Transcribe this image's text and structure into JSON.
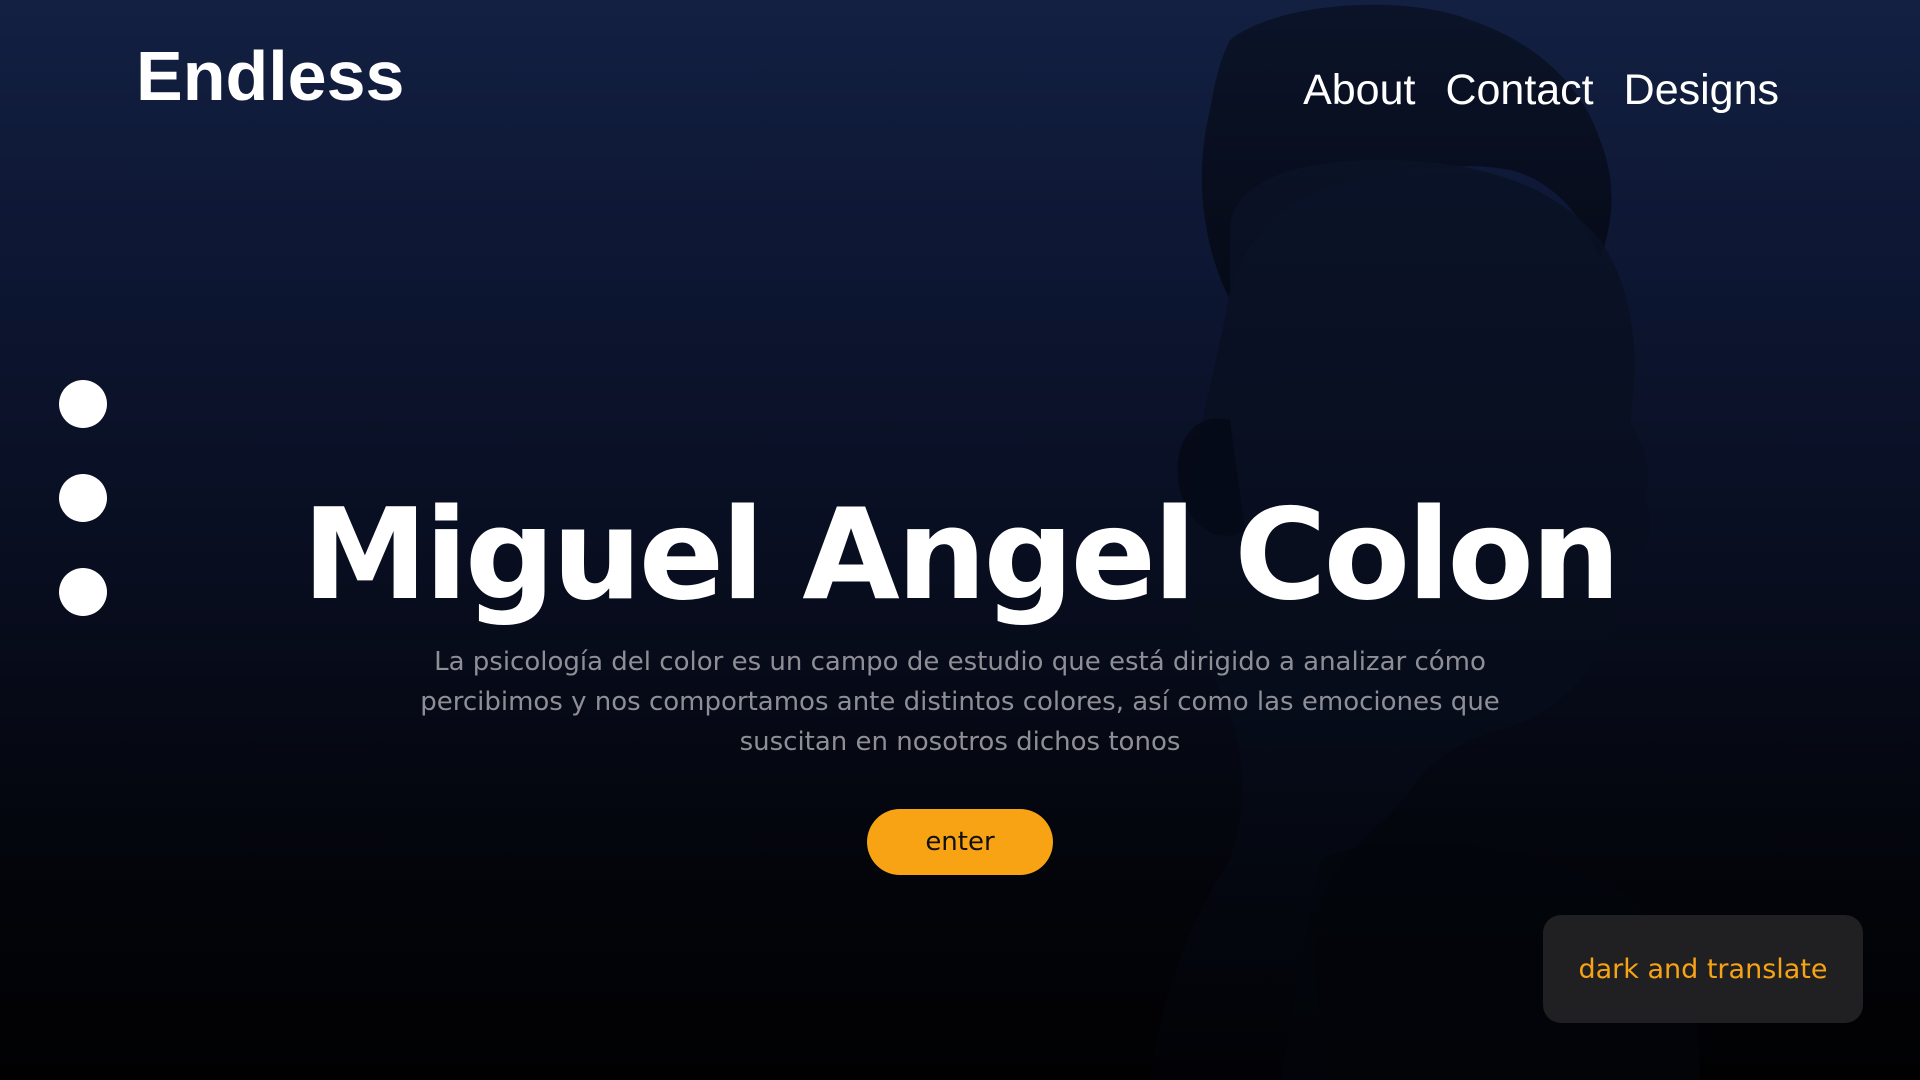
{
  "header": {
    "brand": "Endless",
    "nav": [
      "About",
      "Contact",
      "Designs"
    ]
  },
  "slider": {
    "dots": 3
  },
  "hero": {
    "title": "Miguel Angel Colon",
    "description": "La psicología del color es un campo de estudio que está dirigido a analizar cómo percibimos y nos comportamos ante distintos colores, así como las emociones que suscitan en nosotros dichos tonos",
    "cta_label": "enter"
  },
  "theme_toggle": {
    "label": "dark and translate"
  },
  "colors": {
    "accent": "#f8a313",
    "background_top": "#132042",
    "background_bottom": "#010102",
    "text_muted": "#8e8f96",
    "card": "#202022"
  }
}
